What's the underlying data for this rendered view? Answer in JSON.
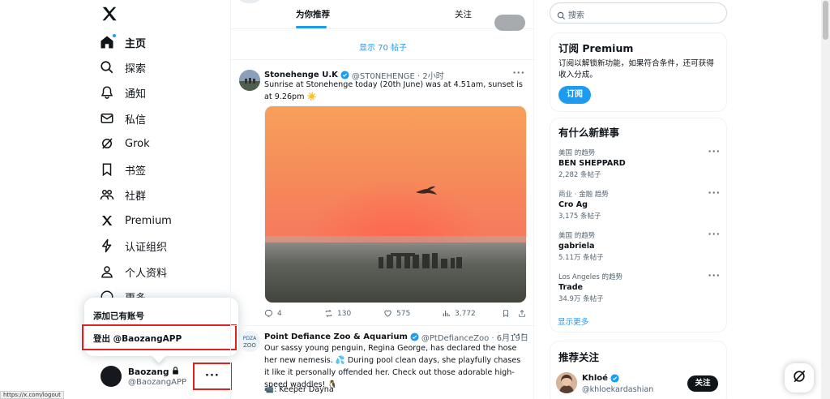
{
  "status_url": "https://x.com/logout",
  "nav": {
    "items": [
      {
        "label": "主页",
        "icon": "home-icon"
      },
      {
        "label": "探索",
        "icon": "search-icon"
      },
      {
        "label": "通知",
        "icon": "bell-icon"
      },
      {
        "label": "私信",
        "icon": "mail-icon"
      },
      {
        "label": "Grok",
        "icon": "grok-icon"
      },
      {
        "label": "书签",
        "icon": "bookmark-icon"
      },
      {
        "label": "社群",
        "icon": "communities-icon"
      },
      {
        "label": "Premium",
        "icon": "x-logo-icon"
      },
      {
        "label": "认证组织",
        "icon": "lightning-icon"
      },
      {
        "label": "个人资料",
        "icon": "person-icon"
      },
      {
        "label": "更多",
        "icon": "more-circle-icon"
      }
    ]
  },
  "account_menu": {
    "add_existing": "添加已有账号",
    "logout": "登出 @BaozangAPP"
  },
  "user": {
    "name": "Baozang",
    "handle": "@BaozangAPP",
    "more": "···"
  },
  "tabs": {
    "for_you": "为你推荐",
    "following": "关注"
  },
  "feed": {
    "show_posts": "显示 70 帖子",
    "tweets": [
      {
        "name": "Stonehenge U.K",
        "handle": "@ST0NEHENGE · 2小时",
        "text": "Sunrise at Stonehenge today (20th June) was at 4.51am, sunset is at 9.26pm ☀️",
        "replies": "4",
        "reposts": "130",
        "likes": "575",
        "views": "3,772"
      },
      {
        "name": "Point Defiance Zoo & Aquarium",
        "handle": "@PtDefianceZoo · 6月19日",
        "text": "Our sassy young penguin, Regina George, has declared the hose her new nemesis. 💦 During pool clean days, she playfully chases it like it personally offended her. Check out those adorable high-speed waddles! 🐧",
        "extra": "📹: Keeper Dayna"
      }
    ]
  },
  "search": {
    "placeholder": "搜索"
  },
  "premium": {
    "title": "订阅 Premium",
    "desc": "订阅以解锁新功能，如果符合条件，还可获得收入分成。",
    "button": "订阅"
  },
  "trends": {
    "title": "有什么新鲜事",
    "items": [
      {
        "category": "美国 的趋势",
        "title": "BEN SHEPPARD",
        "count": "2,282 条帖子"
      },
      {
        "category": "商业 · 金融 趋势",
        "title": "Cro Ag",
        "count": "3,175 条帖子"
      },
      {
        "category": "美国 的趋势",
        "title": "gabriela",
        "count": "5.11万 条帖子"
      },
      {
        "category": "Los Angeles 的趋势",
        "title": "Trade",
        "count": "34.9万 条帖子"
      }
    ],
    "show_more": "显示更多"
  },
  "who_to_follow": {
    "title": "推荐关注",
    "name": "Khloé",
    "handle": "@khloekardashian",
    "button": "关注"
  },
  "colors": {
    "accent": "#1d9bf0",
    "text": "#0f1419",
    "muted": "#536471",
    "highlight": "#e02020"
  }
}
